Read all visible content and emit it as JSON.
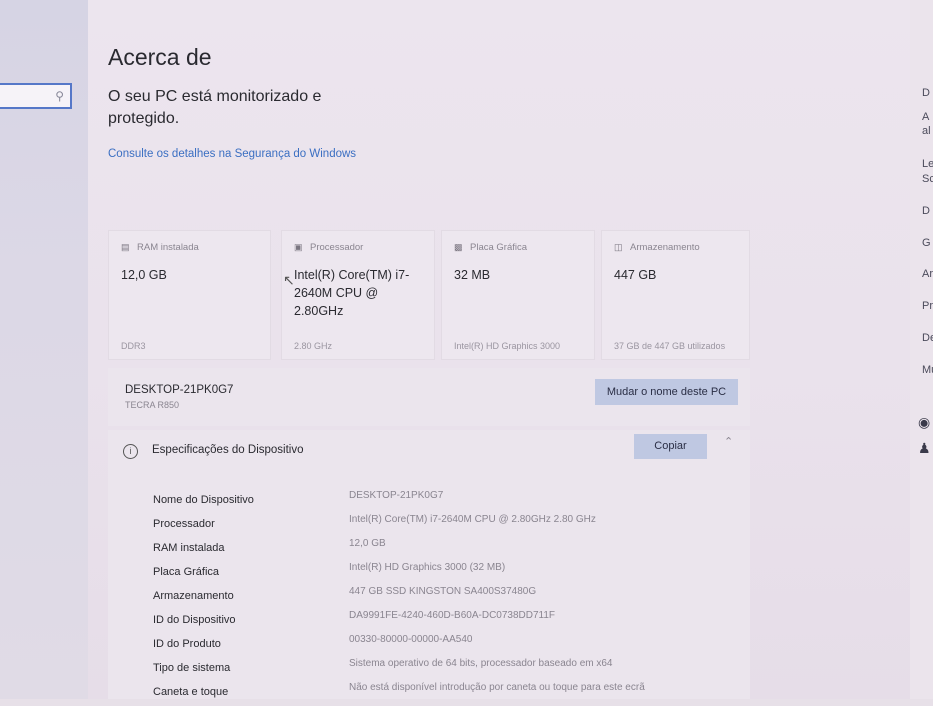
{
  "page": {
    "title": "Acerca de",
    "protection_status": "O seu PC está monitorizado e protegido.",
    "security_link": "Consulte os detalhes na Segurança do Windows"
  },
  "cards": [
    {
      "icon": "ram-icon",
      "header": "RAM instalada",
      "value": "12,0 GB",
      "sub": "DDR3"
    },
    {
      "icon": "processor-icon",
      "header": "Processador",
      "value": "Intel(R) Core(TM) i7-2640M CPU @ 2.80GHz",
      "sub": "2.80 GHz"
    },
    {
      "icon": "graphics-card-icon",
      "header": "Placa Gráfica",
      "value": "32 MB",
      "sub": "Intel(R) HD Graphics 3000"
    },
    {
      "icon": "storage-icon",
      "header": "Armazenamento",
      "value": "447 GB",
      "sub": "37 GB de 447 GB utilizados"
    }
  ],
  "pc": {
    "name": "DESKTOP-21PK0G7",
    "model": "TECRA R850",
    "rename_label": "Mudar o nome deste PC"
  },
  "specs": {
    "title": "Especificações do Dispositivo",
    "copy_label": "Copiar",
    "rows": [
      {
        "label": "Nome do Dispositivo",
        "value": "DESKTOP-21PK0G7"
      },
      {
        "label": "Processador",
        "value": "Intel(R) Core(TM) i7-2640M CPU @ 2.80GHz   2.80 GHz"
      },
      {
        "label": "RAM instalada",
        "value": "12,0 GB"
      },
      {
        "label": "Placa Gráfica",
        "value": "Intel(R) HD Graphics 3000 (32 MB)"
      },
      {
        "label": "Armazenamento",
        "value": "447 GB SSD KINGSTON SA400S37480G"
      },
      {
        "label": "ID do Dispositivo",
        "value": "DA9991FE-4240-460D-B60A-DC0738DD711F"
      },
      {
        "label": "ID do Produto",
        "value": "00330-80000-00000-AA540"
      },
      {
        "label": "Tipo de sistema",
        "value": "Sistema operativo de 64 bits, processador baseado em x64"
      },
      {
        "label": "Caneta e toque",
        "value": "Não está disponível introdução por caneta ou toque para este ecrã"
      }
    ]
  },
  "right_panel": {
    "letters": [
      "D",
      "A",
      "al",
      "Le",
      "Sc",
      "D",
      "G",
      "Ar",
      "Pr",
      "De",
      "Mu"
    ]
  },
  "colors": {
    "accent": "#3b6fc2",
    "button": "#bfc8e2",
    "background": "#ece5ee"
  }
}
